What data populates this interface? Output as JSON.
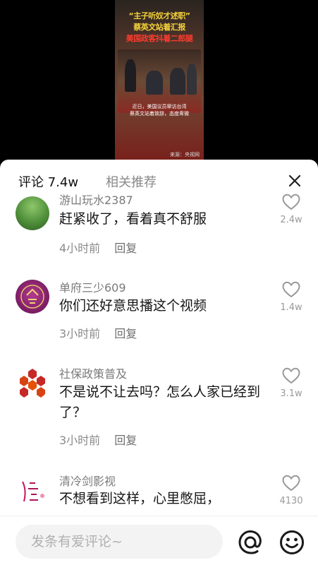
{
  "video": {
    "caption_line1": "“主子听奴才述职”",
    "caption_line2": "蔡英文站着汇报",
    "caption_line3": "美国政客抖着二郎腿",
    "subtitle_line1": "近日，美国议员窜访台湾",
    "subtitle_line2": "蔡英文站着致辞，态度卑微",
    "source": "来源：央视网"
  },
  "sheet": {
    "tab_comments": "评论 7.4w",
    "tab_related": "相关推荐"
  },
  "comments": [
    {
      "username": "游山玩水2387",
      "text": "赶紧收了，看着真不舒服",
      "time": "4小时前",
      "reply": "回复",
      "likes": "2.4w"
    },
    {
      "username": "单府三少609",
      "text": "你们还好意思播这个视频",
      "time": "3小时前",
      "reply": "回复",
      "likes": "1.4w"
    },
    {
      "username": "社保政策普及",
      "text": "不是说不让去吗？怎么人家已经到了？",
      "time": "3小时前",
      "reply": "回复",
      "likes": "3.1w"
    },
    {
      "username": "清冷剑影视",
      "text": "不想看到这样，心里憋屈，",
      "likes": "4130"
    }
  ],
  "input": {
    "placeholder": "发条有爱评论~"
  },
  "icons": {
    "close": "close-icon",
    "like": "heart-outline-icon",
    "at": "at-icon",
    "emoji": "smiley-icon"
  },
  "colors": {
    "caption_yellow": "#f4d23a",
    "caption_red": "#ff3b2e",
    "muted_text": "#8a8a8a",
    "body_text": "#151515"
  }
}
